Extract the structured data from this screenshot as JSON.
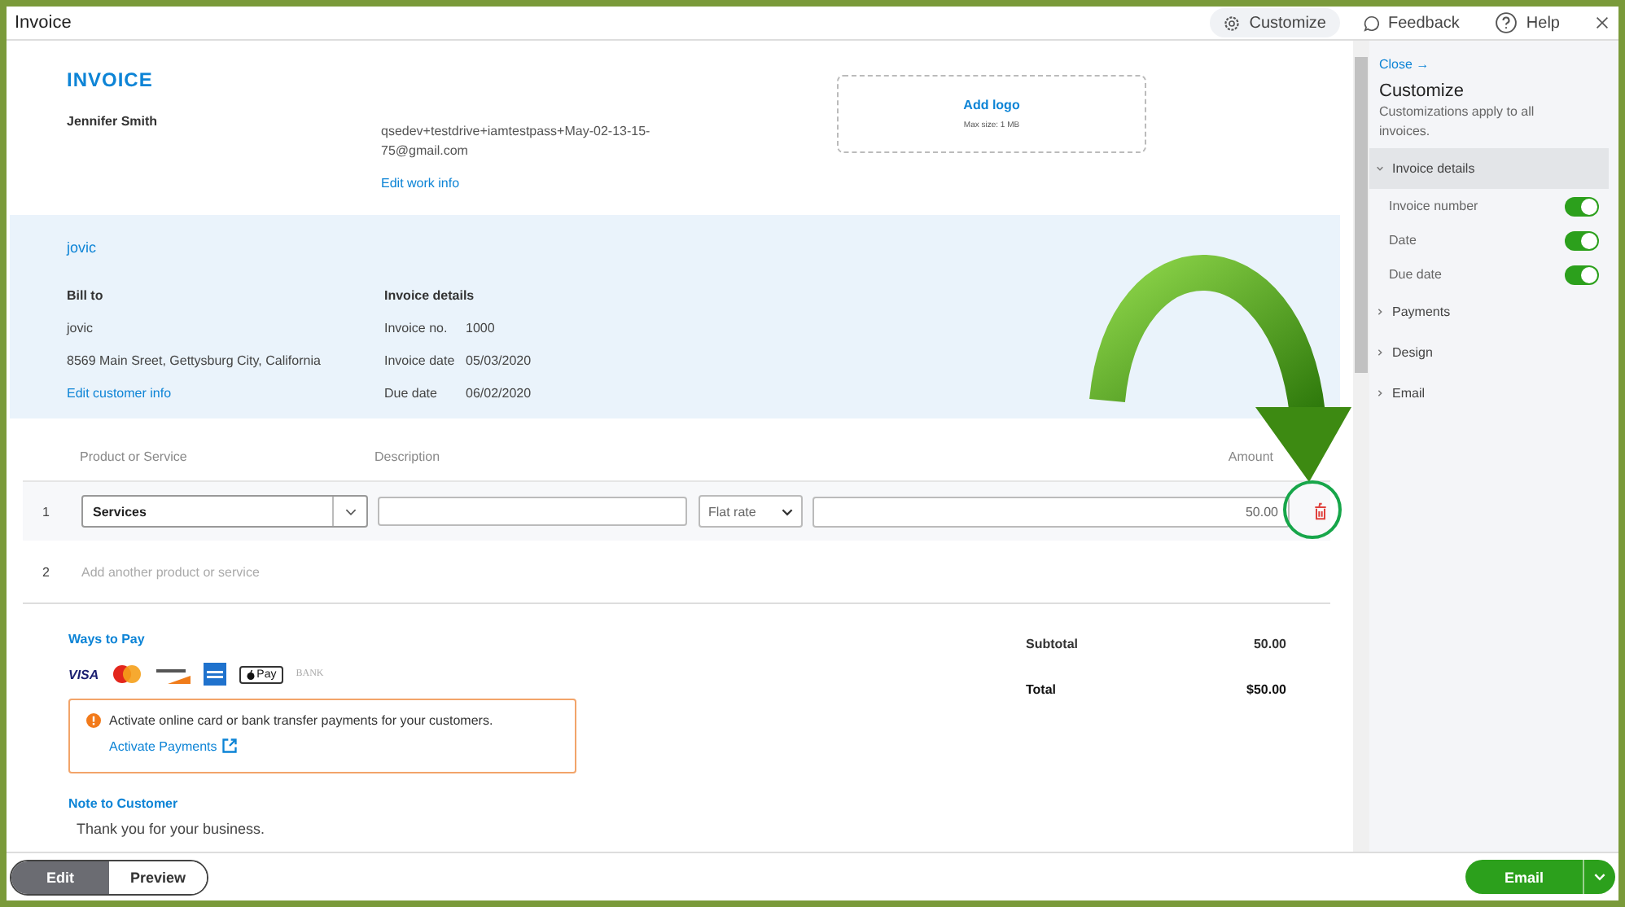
{
  "window": {
    "title": "Invoice"
  },
  "header_actions": [
    {
      "kind": "customize",
      "label": "Customize",
      "selected": true
    },
    {
      "kind": "feedback",
      "label": "Feedback",
      "selected": false
    },
    {
      "kind": "help",
      "label": "Help",
      "selected": false
    }
  ],
  "invoice": {
    "heading": "INVOICE",
    "company_name": "Jennifer Smith",
    "email": "qsedev+testdrive+iamtestpass+May-02-13-15-75@gmail.com",
    "edit_work_info": "Edit work info",
    "logo": {
      "label": "Add logo",
      "hint": "Max size: 1 MB"
    }
  },
  "customer": {
    "name": "jovic",
    "bill_to": {
      "title": "Bill to",
      "lines": [
        "jovic",
        "8569 Main Sreet, Gettysburg City, California"
      ],
      "edit_link": "Edit customer info"
    },
    "details": {
      "title": "Invoice details",
      "rows": [
        {
          "label": "Invoice no.",
          "value": "1000"
        },
        {
          "label": "Invoice date",
          "value": "05/03/2020"
        },
        {
          "label": "Due date",
          "value": "06/02/2020"
        }
      ]
    }
  },
  "table": {
    "columns": [
      "Product or Service",
      "Description",
      "Amount"
    ],
    "rows": [
      {
        "number": "1",
        "product": "Services",
        "rate_type": "Flat rate",
        "amount": "50.00"
      }
    ],
    "add_row": {
      "number": "2",
      "placeholder": "Add another product or service"
    }
  },
  "ways_to_pay": {
    "title": "Ways to Pay",
    "methods": [
      {
        "kind": "visa",
        "label": "VISA"
      },
      {
        "kind": "mastercard"
      },
      {
        "kind": "discover"
      },
      {
        "kind": "amex"
      },
      {
        "kind": "applepay",
        "label": "Pay"
      },
      {
        "kind": "bank",
        "label": "BANK"
      }
    ],
    "alert": {
      "message": "Activate online card or bank transfer payments for your customers.",
      "link": "Activate Payments"
    }
  },
  "note": {
    "title": "Note to Customer",
    "text": "Thank you for your business."
  },
  "totals": [
    {
      "label": "Subtotal",
      "value": "50.00",
      "kind": "subtotal"
    },
    {
      "label": "Total",
      "value": "$50.00",
      "kind": "total"
    }
  ],
  "sidebar": {
    "close": "Close →",
    "title": "Customize",
    "subtitle": "Customizations apply to all invoices.",
    "sections": [
      {
        "title": "Invoice details",
        "expanded": true,
        "toggles": [
          {
            "label": "Invoice number",
            "on": true
          },
          {
            "label": "Date",
            "on": true
          },
          {
            "label": "Due date",
            "on": true
          }
        ]
      },
      {
        "title": "Payments",
        "expanded": false
      },
      {
        "title": "Design",
        "expanded": false
      },
      {
        "title": "Email",
        "expanded": false
      }
    ]
  },
  "footer": {
    "modes": [
      {
        "label": "Edit",
        "selected": true
      },
      {
        "label": "Preview",
        "selected": false
      }
    ],
    "email_button": "Email"
  }
}
